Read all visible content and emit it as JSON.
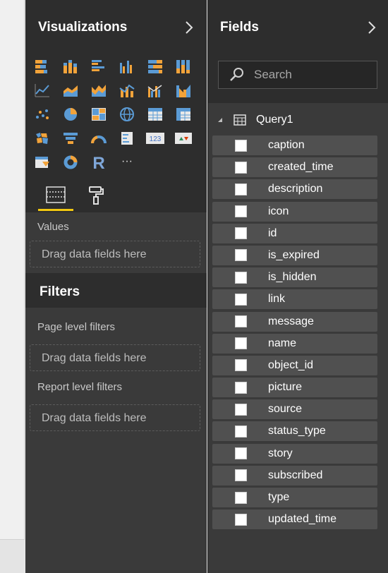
{
  "visualizations": {
    "title": "Visualizations",
    "icon_rows": [
      [
        "stacked-bar-chart-icon",
        "stacked-column-chart-icon",
        "clustered-bar-chart-icon",
        "clustered-column-chart-icon",
        "100pct-stacked-bar-chart-icon",
        "100pct-stacked-column-chart-icon"
      ],
      [
        "line-chart-icon",
        "area-chart-icon",
        "stacked-area-chart-icon",
        "line-and-column-chart-icon",
        "line-and-clustered-column-chart-icon",
        "ribbon-chart-icon"
      ],
      [
        "scatter-chart-icon",
        "pie-chart-icon",
        "treemap-icon",
        "map-icon",
        "table-icon",
        "matrix-icon"
      ],
      [
        "filled-map-icon",
        "funnel-icon",
        "gauge-icon",
        "multi-row-card-icon",
        "card-icon",
        "kpi-icon"
      ],
      [
        "slicer-icon",
        "donut-chart-icon",
        "r-script-visual-icon",
        "more-visuals-icon"
      ]
    ],
    "card_icon_text": "123",
    "r_icon_text": "R",
    "more_icon_text": "···",
    "values_label": "Values",
    "values_placeholder": "Drag data fields here"
  },
  "filters": {
    "title": "Filters",
    "page_level_label": "Page level filters",
    "page_level_placeholder": "Drag data fields here",
    "report_level_label": "Report level filters",
    "report_level_placeholder": "Drag data fields here"
  },
  "fields": {
    "title": "Fields",
    "search_placeholder": "Search",
    "table_name": "Query1",
    "items": [
      "caption",
      "created_time",
      "description",
      "icon",
      "id",
      "is_expired",
      "is_hidden",
      "link",
      "message",
      "name",
      "object_id",
      "picture",
      "source",
      "status_type",
      "story",
      "subscribed",
      "type",
      "updated_time"
    ]
  },
  "colors": {
    "pane_bg": "#3a3a3a",
    "header_bg": "#2d2d2d",
    "accent_yellow": "#f2c811",
    "icon_orange": "#f2a33a",
    "icon_blue": "#5b9bd5",
    "field_row_bg": "#505050"
  }
}
